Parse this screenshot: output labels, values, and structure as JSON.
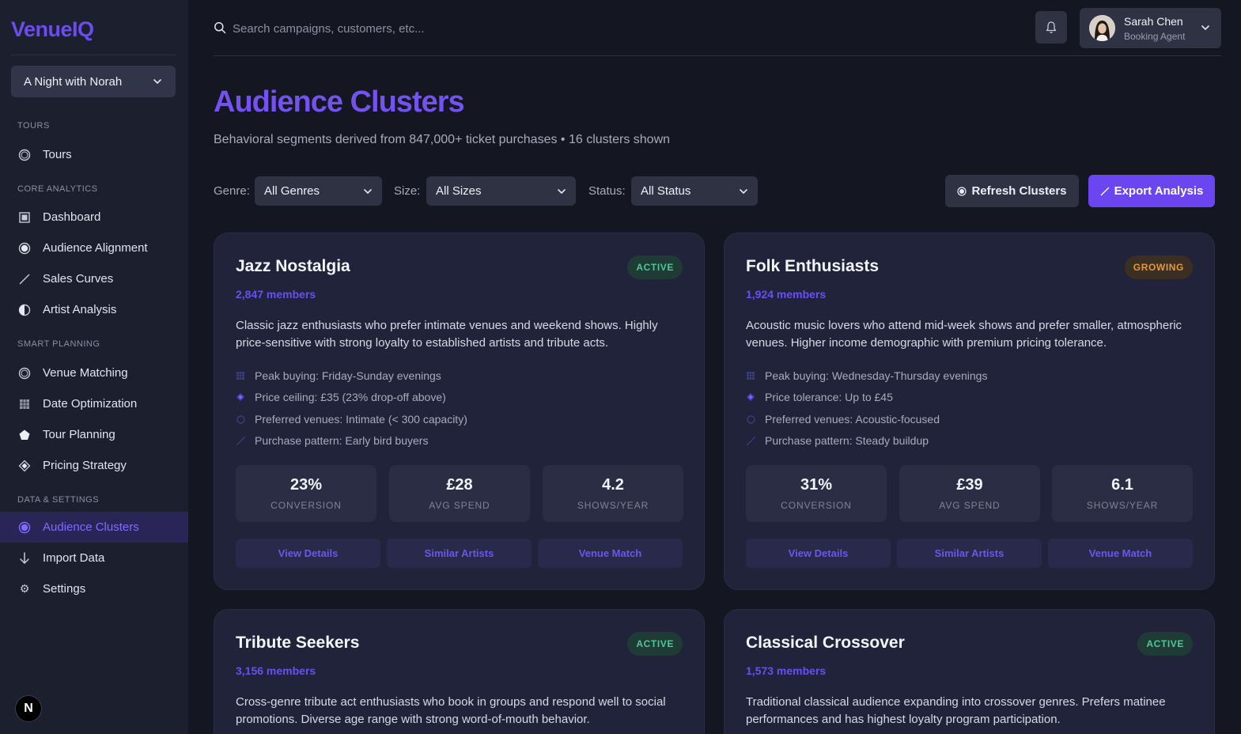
{
  "app": {
    "logo": "VenueIQ"
  },
  "sidebar": {
    "project": "A Night with Norah",
    "sections": {
      "tours": "TOURS",
      "core": "CORE ANALYTICS",
      "smart": "SMART PLANNING",
      "data": "DATA & SETTINGS"
    },
    "items": [
      {
        "label": "Tours",
        "icon": "circle-outline-icon"
      },
      {
        "label": "Dashboard",
        "icon": "square-icon"
      },
      {
        "label": "Audience Alignment",
        "icon": "circle-dot-icon"
      },
      {
        "label": "Sales Curves",
        "icon": "trend-line-icon"
      },
      {
        "label": "Artist Analysis",
        "icon": "half-circle-icon"
      },
      {
        "label": "Venue Matching",
        "icon": "circle-outline-icon"
      },
      {
        "label": "Date Optimization",
        "icon": "grid-icon"
      },
      {
        "label": "Tour Planning",
        "icon": "pentagon-icon"
      },
      {
        "label": "Pricing Strategy",
        "icon": "diamond-icon"
      },
      {
        "label": "Audience Clusters",
        "icon": "circle-dot-icon",
        "active": true
      },
      {
        "label": "Import Data",
        "icon": "arrow-down-icon"
      },
      {
        "label": "Settings",
        "icon": "gear-icon"
      }
    ],
    "bottom_badge": "N"
  },
  "header": {
    "search_placeholder": "Search campaigns, customers, etc...",
    "user": {
      "name": "Sarah Chen",
      "role": "Booking Agent"
    }
  },
  "page": {
    "title": "Audience Clusters",
    "subtitle": "Behavioral segments derived from 847,000+ ticket purchases • 16 clusters shown"
  },
  "filters": {
    "genre": {
      "label": "Genre:",
      "value": "All Genres"
    },
    "size": {
      "label": "Size:",
      "value": "All Sizes"
    },
    "status": {
      "label": "Status:",
      "value": "All Status"
    },
    "refresh_label": "Refresh Clusters",
    "export_label": "Export Analysis"
  },
  "cards": [
    {
      "name": "Jazz Nostalgia",
      "badge": "ACTIVE",
      "members": "2,847 members",
      "description": "Classic jazz enthusiasts who prefer intimate venues and weekend shows. Highly price-sensitive with strong loyalty to established artists and tribute acts.",
      "traits": [
        "Peak buying: Friday-Sunday evenings",
        "Price ceiling: £35 (23% drop-off above)",
        "Preferred venues: Intimate (< 300 capacity)",
        "Purchase pattern: Early bird buyers"
      ],
      "metrics": [
        {
          "value": "23%",
          "label": "CONVERSION"
        },
        {
          "value": "£28",
          "label": "AVG SPEND"
        },
        {
          "value": "4.2",
          "label": "SHOWS/YEAR"
        }
      ],
      "actions": [
        "View Details",
        "Similar Artists",
        "Venue Match"
      ]
    },
    {
      "name": "Folk Enthusiasts",
      "badge": "GROWING",
      "members": "1,924 members",
      "description": "Acoustic music lovers who attend mid-week shows and prefer smaller, atmospheric venues. Higher income demographic with premium pricing tolerance.",
      "traits": [
        "Peak buying: Wednesday-Thursday evenings",
        "Price tolerance: Up to £45",
        "Preferred venues: Acoustic-focused",
        "Purchase pattern: Steady buildup"
      ],
      "metrics": [
        {
          "value": "31%",
          "label": "CONVERSION"
        },
        {
          "value": "£39",
          "label": "AVG SPEND"
        },
        {
          "value": "6.1",
          "label": "SHOWS/YEAR"
        }
      ],
      "actions": [
        "View Details",
        "Similar Artists",
        "Venue Match"
      ]
    },
    {
      "name": "Tribute Seekers",
      "badge": "ACTIVE",
      "members": "3,156 members",
      "description": "Cross-genre tribute act enthusiasts who book in groups and respond well to social promotions. Diverse age range with strong word-of-mouth behavior."
    },
    {
      "name": "Classical Crossover",
      "badge": "ACTIVE",
      "members": "1,573 members",
      "description": "Traditional classical audience expanding into crossover genres. Prefers matinee performances and has highest loyalty program participation."
    }
  ],
  "colors": {
    "accent": "#6b46f0",
    "active_badge": "#4fc795",
    "growing_badge": "#e5963f",
    "background": "#141621",
    "sidebar": "#1c1f2e",
    "card": "#20233a"
  }
}
